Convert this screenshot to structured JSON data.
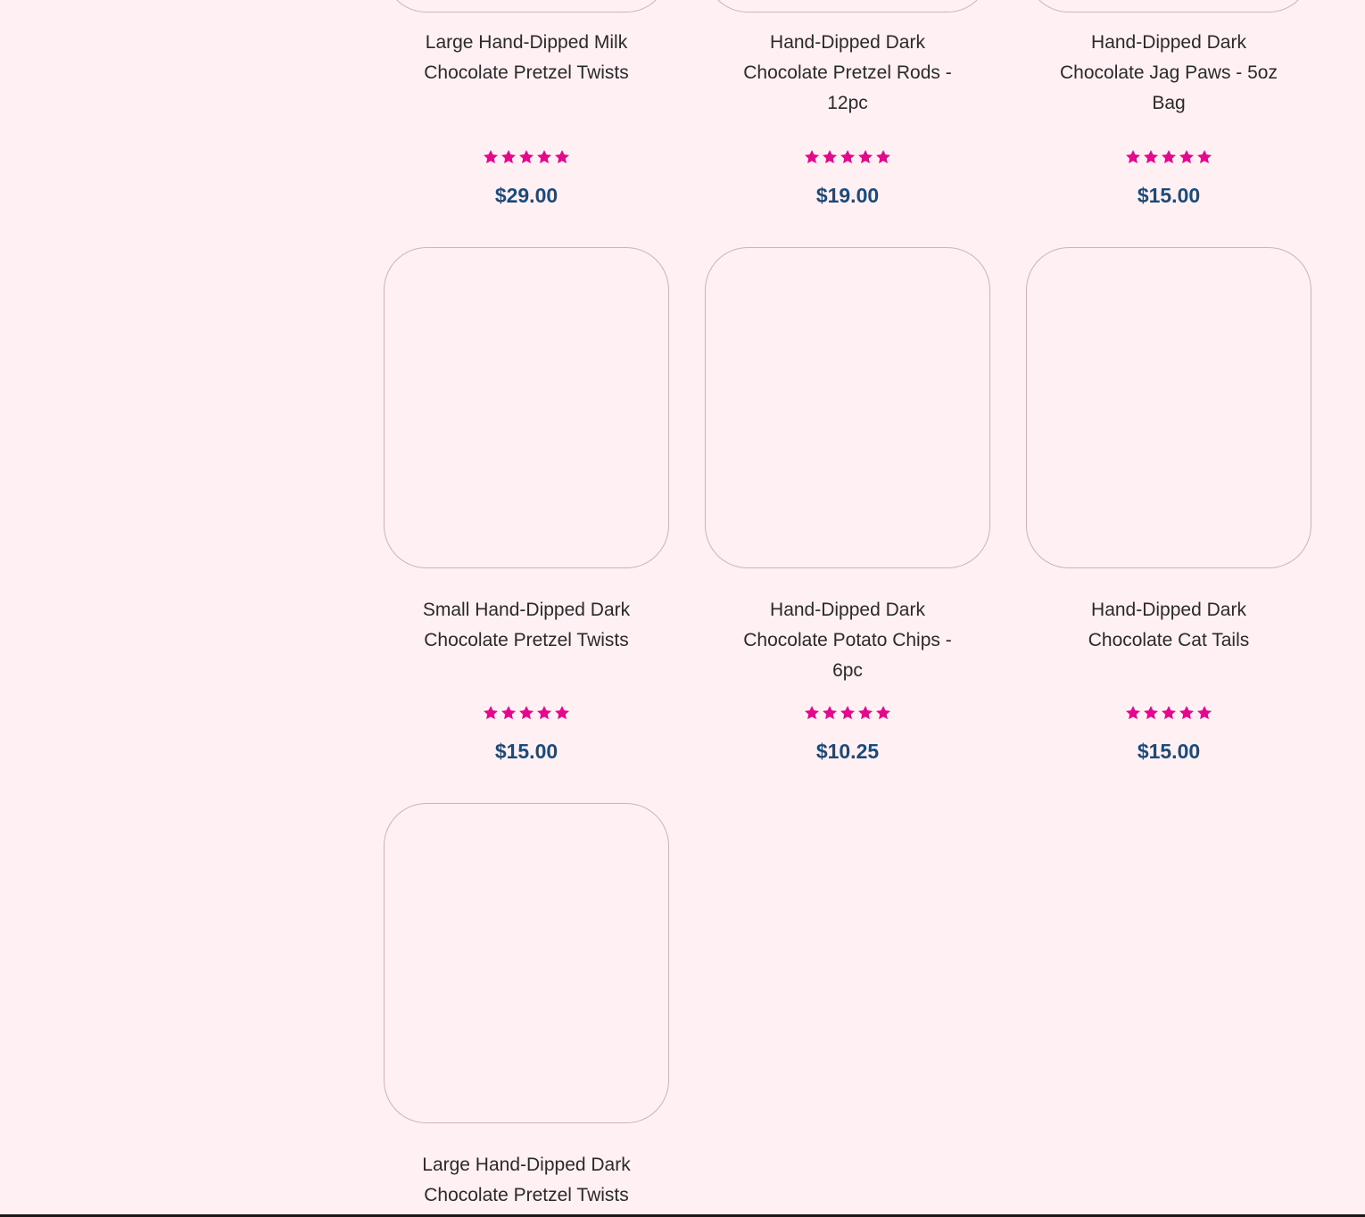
{
  "products": [
    {
      "title": "Large Hand-Dipped Milk Chocolate Pretzel Twists",
      "price": "$29.00",
      "rating": 5
    },
    {
      "title": "Hand-Dipped Dark Chocolate Pretzel Rods - 12pc",
      "price": "$19.00",
      "rating": 5
    },
    {
      "title": "Hand-Dipped Dark Chocolate Jag Paws - 5oz Bag",
      "price": "$15.00",
      "rating": 5
    },
    {
      "title": "Small Hand-Dipped Dark Chocolate Pretzel Twists",
      "price": "$15.00",
      "rating": 5
    },
    {
      "title": "Hand-Dipped Dark Chocolate Potato Chips - 6pc",
      "price": "$10.25",
      "rating": 5
    },
    {
      "title": "Hand-Dipped Dark Chocolate Cat Tails",
      "price": "$15.00",
      "rating": 5
    },
    {
      "title": "Large Hand-Dipped Dark Chocolate Pretzel Twists",
      "price": "",
      "rating": 0
    }
  ],
  "colors": {
    "background": "#fff0f3",
    "star": "#e4098c",
    "price": "#1b4b7a",
    "title": "#2a2a2a",
    "card_border": "#cdb2bb"
  },
  "icons": {
    "rating": "star-icon"
  }
}
